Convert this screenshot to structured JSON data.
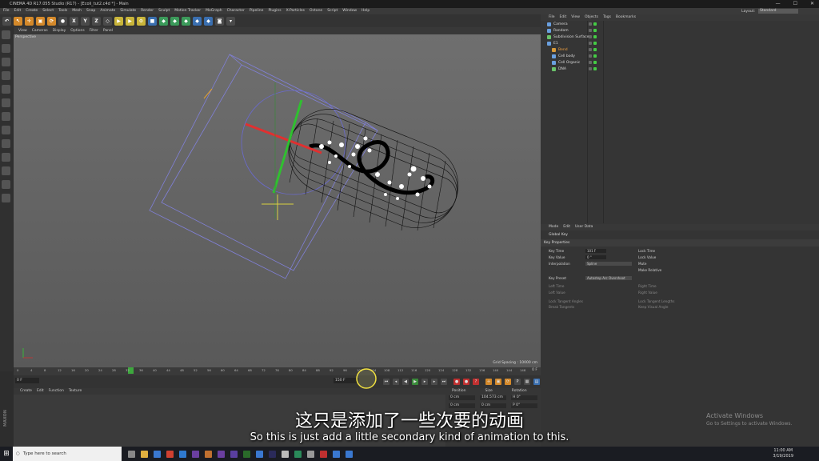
{
  "window": {
    "title": "CINEMA 4D R17.055 Studio (R17) - [Ecoli_tut2.c4d *] - Main",
    "controls": [
      "—",
      "☐",
      "✕"
    ]
  },
  "menu": [
    "File",
    "Edit",
    "Create",
    "Select",
    "Tools",
    "Mesh",
    "Snap",
    "Animate",
    "Simulate",
    "Render",
    "Sculpt",
    "Motion Tracker",
    "MoGraph",
    "Character",
    "Pipeline",
    "Plugins",
    "X-Particles",
    "Octane",
    "Script",
    "Window",
    "Help"
  ],
  "layout": {
    "label": "Layout:",
    "value": "Standard"
  },
  "toolbar_letters": {
    "x": "X",
    "y": "Y",
    "z": "Z"
  },
  "viewport": {
    "menu": [
      "View",
      "Cameras",
      "Display",
      "Options",
      "Filter",
      "Panel"
    ],
    "label": "Perspective",
    "grid_spacing": "Grid Spacing : 10000 cm"
  },
  "timeline": {
    "ticks": [
      "0",
      "4",
      "8",
      "12",
      "16",
      "20",
      "24",
      "28",
      "32",
      "36",
      "40",
      "44",
      "48",
      "52",
      "56",
      "60",
      "64",
      "68",
      "72",
      "76",
      "80",
      "84",
      "88",
      "92",
      "96",
      "100",
      "104",
      "108",
      "112",
      "116",
      "120",
      "124",
      "128",
      "132",
      "136",
      "140",
      "144",
      "148"
    ],
    "current_frame": "12",
    "end_label": "0 F",
    "frame_field": "0 F",
    "end_field": "150 F"
  },
  "materials": {
    "menu": [
      "Create",
      "Edit",
      "Function",
      "Texture"
    ]
  },
  "coords": {
    "headers": [
      "Position",
      "Size",
      "Rotation"
    ],
    "rows": [
      [
        "0 cm",
        "104.573 cm",
        "H 0°"
      ],
      [
        "0 cm",
        "0 cm",
        "P 0°"
      ]
    ]
  },
  "objects": {
    "menu": [
      "File",
      "Edit",
      "View",
      "Objects",
      "Tags",
      "Bookmarks"
    ],
    "items": [
      {
        "name": "Camera",
        "color": "#6aa0e0",
        "indent": 0
      },
      {
        "name": "Random",
        "color": "#6aa0e0",
        "indent": 0
      },
      {
        "name": "Subdivision Surface",
        "color": "#6ac36a",
        "indent": 0
      },
      {
        "name": "E1",
        "color": "#6aa0e0",
        "indent": 0
      },
      {
        "name": "Bend",
        "color": "#d89a3a",
        "indent": 1
      },
      {
        "name": "Cell body",
        "color": "#6aa0e0",
        "indent": 1
      },
      {
        "name": "Cell Organic",
        "color": "#6aa0e0",
        "indent": 1
      },
      {
        "name": "DNA",
        "color": "#6ac36a",
        "indent": 1
      }
    ]
  },
  "attributes": {
    "menu": [
      "Mode",
      "Edit",
      "User Data"
    ],
    "title": "Global Key",
    "section": "Key Properties",
    "key_time_label": "Key Time",
    "key_time": "101 F",
    "key_value_label": "Key Value",
    "key_value": "0 °",
    "interpolation_label": "Interpolation",
    "interpolation": "Spline",
    "lock_time": "Lock Time",
    "lock_value": "Lock Value",
    "mute": "Mute",
    "make_relative": "Make Relative",
    "key_preset_label": "Key Preset",
    "key_preset": "Autostep Arc Overshoot",
    "left_time": "Left Time",
    "left_value": "Left Value",
    "right_time": "Right Time",
    "right_value": "Right Value",
    "lock_tangent_angles": "Lock Tangent Angles",
    "break_tangents": "Break Tangents",
    "lock_tangent_lengths": "Lock Tangent Lengths",
    "keep_visual_angle": "Keep Visual Angle"
  },
  "subtitles": {
    "chinese": "这只是添加了一些次要的动画",
    "english": "So this is just add a little secondary kind of animation to this."
  },
  "watermark": {
    "title": "Activate Windows",
    "subtitle": "Go to Settings to activate Windows."
  },
  "taskbar": {
    "search_placeholder": "Type here to search",
    "time": "11:00 AM",
    "date": "3/19/2019"
  },
  "branding": {
    "maxon": "MAXON"
  }
}
